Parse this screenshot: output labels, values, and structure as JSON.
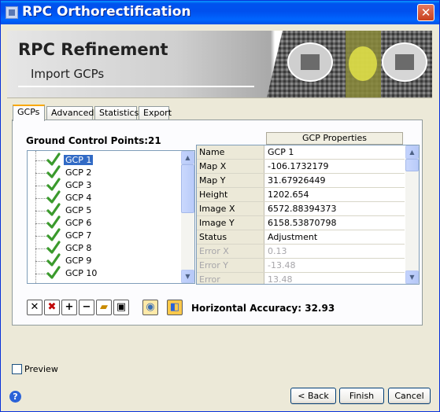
{
  "window": {
    "title": "RPC Orthorectification",
    "close_glyph": "✕"
  },
  "header": {
    "title": "RPC Refinement",
    "subtitle": "Import GCPs"
  },
  "tabs": [
    {
      "label": "GCPs",
      "active": true
    },
    {
      "label": "Advanced",
      "active": false
    },
    {
      "label": "Statistics",
      "active": false
    },
    {
      "label": "Export",
      "active": false
    }
  ],
  "gcp_panel": {
    "label": "Ground Control Points:",
    "count": "21",
    "items": [
      "GCP 1",
      "GCP 2",
      "GCP 3",
      "GCP 4",
      "GCP 5",
      "GCP 6",
      "GCP 7",
      "GCP 8",
      "GCP 9",
      "GCP 10"
    ],
    "selected_index": 0
  },
  "properties": {
    "header": "GCP Properties",
    "rows": [
      {
        "name": "Name",
        "value": "GCP 1",
        "enabled": true
      },
      {
        "name": "Map X",
        "value": "-106.1732179",
        "enabled": true
      },
      {
        "name": "Map Y",
        "value": "31.67926449",
        "enabled": true
      },
      {
        "name": "Height",
        "value": "1202.654",
        "enabled": true
      },
      {
        "name": "Image X",
        "value": "6572.88394373",
        "enabled": true
      },
      {
        "name": "Image Y",
        "value": "6158.53870798",
        "enabled": true
      },
      {
        "name": "Status",
        "value": "Adjustment",
        "enabled": true
      },
      {
        "name": "Error X",
        "value": "0.13",
        "enabled": false
      },
      {
        "name": "Error Y",
        "value": "-13.48",
        "enabled": false
      },
      {
        "name": "Error Magnitude",
        "value": "13.48",
        "enabled": false
      }
    ]
  },
  "toolbar": {
    "icons": [
      "close-icon",
      "delete-icon",
      "add-icon",
      "remove-icon",
      "open-folder-icon",
      "save-icon",
      "view-icon",
      "chart-icon"
    ],
    "accuracy_label": "Horizontal Accuracy:",
    "accuracy_value": "32.93"
  },
  "footer": {
    "preview_label": "Preview",
    "back_label": "< Back",
    "finish_label": "Finish",
    "cancel_label": "Cancel",
    "help_glyph": "?"
  },
  "colors": {
    "titlebar": "#0053ee",
    "selection": "#316ac5",
    "tab_highlight": "#f9a800"
  }
}
